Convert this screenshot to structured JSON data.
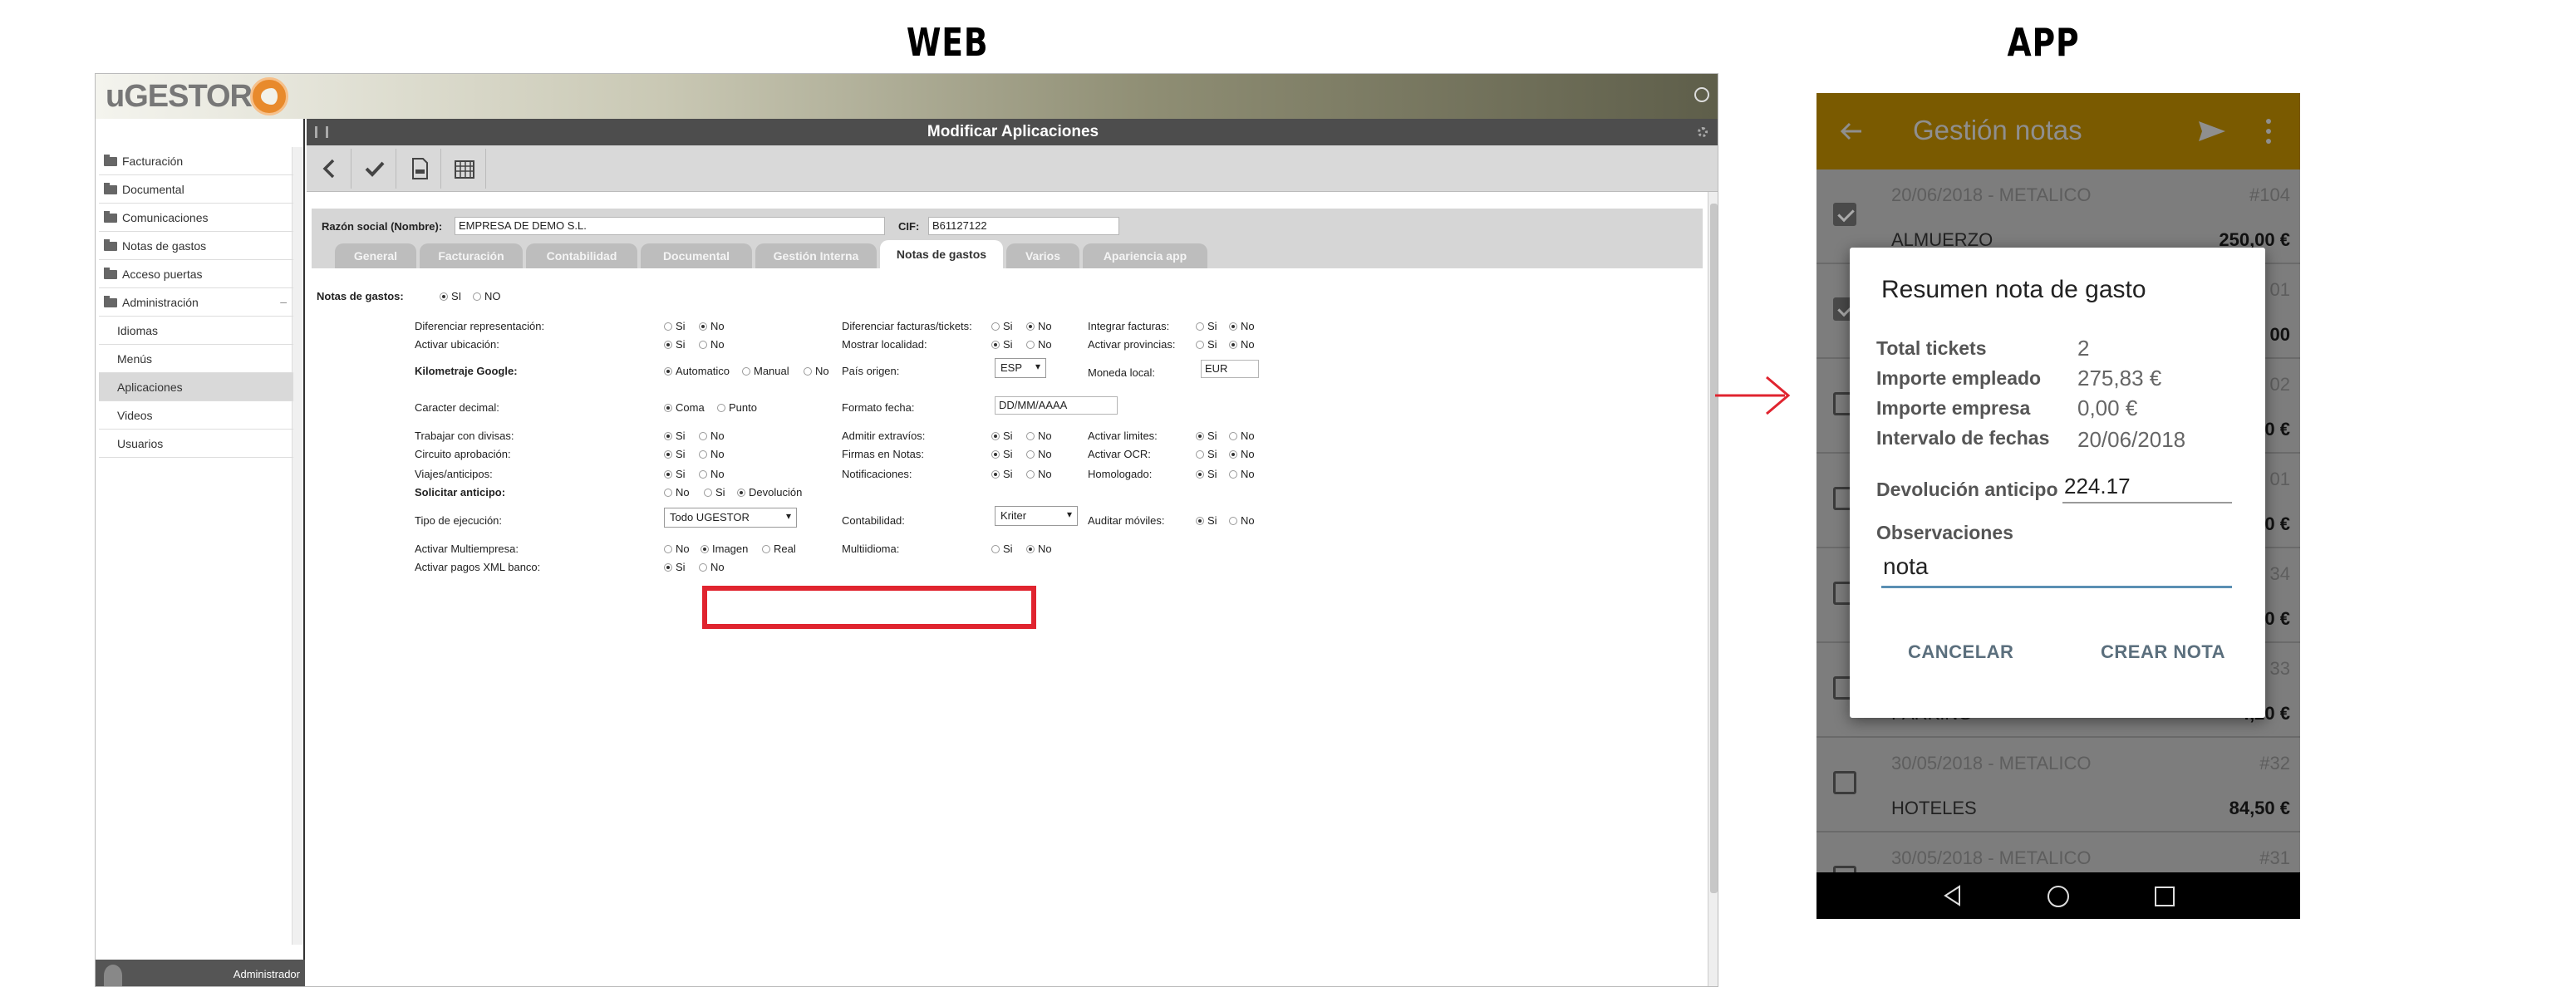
{
  "labels": {
    "web": "WEB",
    "app": "APP"
  },
  "web": {
    "logo": "uGESTOR",
    "sidebar": {
      "items": [
        "Facturación",
        "Documental",
        "Comunicaciones",
        "Notas de gastos",
        "Acceso puertas",
        "Administración"
      ],
      "subitems": [
        "Idiomas",
        "Menús",
        "Aplicaciones",
        "Videos",
        "Usuarios"
      ],
      "active": "Aplicaciones",
      "footer_user": "Administrador"
    },
    "title": "Modificar Aplicaciones",
    "company": {
      "name_label": "Razón social (Nombre):",
      "name_value": "EMPRESA DE DEMO S.L.",
      "cif_label": "CIF:",
      "cif_value": "B61127122"
    },
    "tabs": [
      "General",
      "Facturación",
      "Contabilidad",
      "Documental",
      "Gestión Interna",
      "Notas de gastos",
      "Varios",
      "Apariencia app"
    ],
    "active_tab": "Notas de gastos",
    "form": {
      "notas_label": "Notas de gastos:",
      "si": "SI",
      "no_upper": "NO",
      "opt_si": "Si",
      "opt_no": "No",
      "diferenciar_representacion": "Diferenciar representación:",
      "activar_ubicacion": "Activar ubicación:",
      "kilometraje": "Kilometraje Google:",
      "automatico": "Automatico",
      "manual": "Manual",
      "caracter_decimal": "Caracter decimal:",
      "coma": "Coma",
      "punto": "Punto",
      "trabajar_divisas": "Trabajar con divisas:",
      "circuito_aprobacion": "Circuito aprobación:",
      "viajes_anticipos": "Viajes/anticipos:",
      "solicitar_anticipo": "Solicitar anticipo:",
      "devolucion": "Devolución",
      "tipo_ejecucion": "Tipo de ejecución:",
      "tipo_ejecucion_value": "Todo UGESTOR",
      "activar_multiempresa": "Activar Multiempresa:",
      "imagen": "Imagen",
      "real": "Real",
      "activar_pagos": "Activar pagos XML banco:",
      "diferenciar_facturas": "Diferenciar facturas/tickets:",
      "mostrar_localidad": "Mostrar localidad:",
      "pais_origen": "País origen:",
      "pais_value": "ESP",
      "formato_fecha": "Formato fecha:",
      "formato_value": "DD/MM/AAAA",
      "admitir_extravios": "Admitir extravíos:",
      "firmas_notas": "Firmas en Notas:",
      "notificaciones": "Notificaciones:",
      "contabilidad": "Contabilidad:",
      "contabilidad_value": "Kriter",
      "multiidioma": "Multiidioma:",
      "integrar_facturas": "Integrar facturas:",
      "activar_provincias": "Activar provincias:",
      "moneda_local": "Moneda local:",
      "moneda_value": "EUR",
      "activar_limites": "Activar limites:",
      "activar_ocr": "Activar OCR:",
      "homologado": "Homologado:",
      "auditar_moviles": "Auditar móviles:"
    }
  },
  "app": {
    "title": "Gestión notas",
    "rows": [
      {
        "date": "20/06/2018 - METALICO",
        "num": "#104",
        "concept": "ALMUERZO",
        "amount": "250,00 €",
        "checked": true
      },
      {
        "date": "",
        "num": "01",
        "concept": "",
        "amount": "00",
        "checked": true
      },
      {
        "date": "",
        "num": "02",
        "concept": "",
        "amount": "0 €",
        "checked": false
      },
      {
        "date": "",
        "num": "01",
        "concept": "",
        "amount": "0 €",
        "checked": false
      },
      {
        "date": "",
        "num": "34",
        "concept": "",
        "amount": "0 €",
        "checked": false
      },
      {
        "date": "",
        "num": "33",
        "concept": "PARKING",
        "amount": "4,20 €",
        "checked": false
      },
      {
        "date": "30/05/2018 - METALICO",
        "num": "#32",
        "concept": "HOTELES",
        "amount": "84,50 €",
        "checked": false
      },
      {
        "date": "30/05/2018 - METALICO",
        "num": "#31",
        "concept": "",
        "amount": "",
        "checked": false
      }
    ],
    "dialog": {
      "title": "Resumen nota de gasto",
      "total_tickets_label": "Total tickets",
      "total_tickets_value": "2",
      "importe_empleado_label": "Importe empleado",
      "importe_empleado_value": "275,83 €",
      "importe_empresa_label": "Importe empresa",
      "importe_empresa_value": "0,00 €",
      "intervalo_label": "Intervalo de fechas",
      "intervalo_value": "20/06/2018",
      "devolucion_label": "Devolución anticipo",
      "devolucion_value": "224.17",
      "observaciones_label": "Observaciones",
      "observaciones_value": "nota",
      "cancel": "CANCELAR",
      "create": "CREAR NOTA"
    }
  },
  "colors": {
    "highlight": "#e0242f",
    "app_bar": "#7a5a00",
    "accent_blue": "#5a8fb3"
  }
}
